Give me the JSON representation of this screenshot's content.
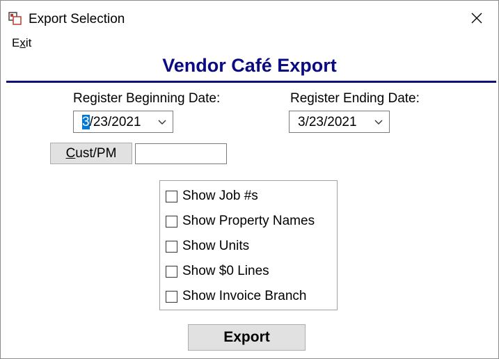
{
  "window": {
    "title": "Export Selection"
  },
  "menu": {
    "exit_before": "E",
    "exit_underlined": "x",
    "exit_after": "it"
  },
  "heading": "Vendor Café Export",
  "begin": {
    "label": "Register Beginning Date:",
    "selected_part": "3",
    "rest": "/23/2021"
  },
  "end": {
    "label": "Register Ending Date:",
    "value": "3/23/2021"
  },
  "custpm": {
    "underlined": "C",
    "rest": "ust/PM",
    "value": ""
  },
  "options": [
    {
      "label": "Show Job #s",
      "checked": false
    },
    {
      "label": "Show Property Names",
      "checked": false
    },
    {
      "label": "Show Units",
      "checked": false
    },
    {
      "label": "Show $0 Lines",
      "checked": false
    },
    {
      "label": "Show Invoice Branch",
      "checked": false
    }
  ],
  "export_button": "Export",
  "colors": {
    "heading": "#0a0a82",
    "rule": "#10107a",
    "selection": "#0078d7"
  }
}
